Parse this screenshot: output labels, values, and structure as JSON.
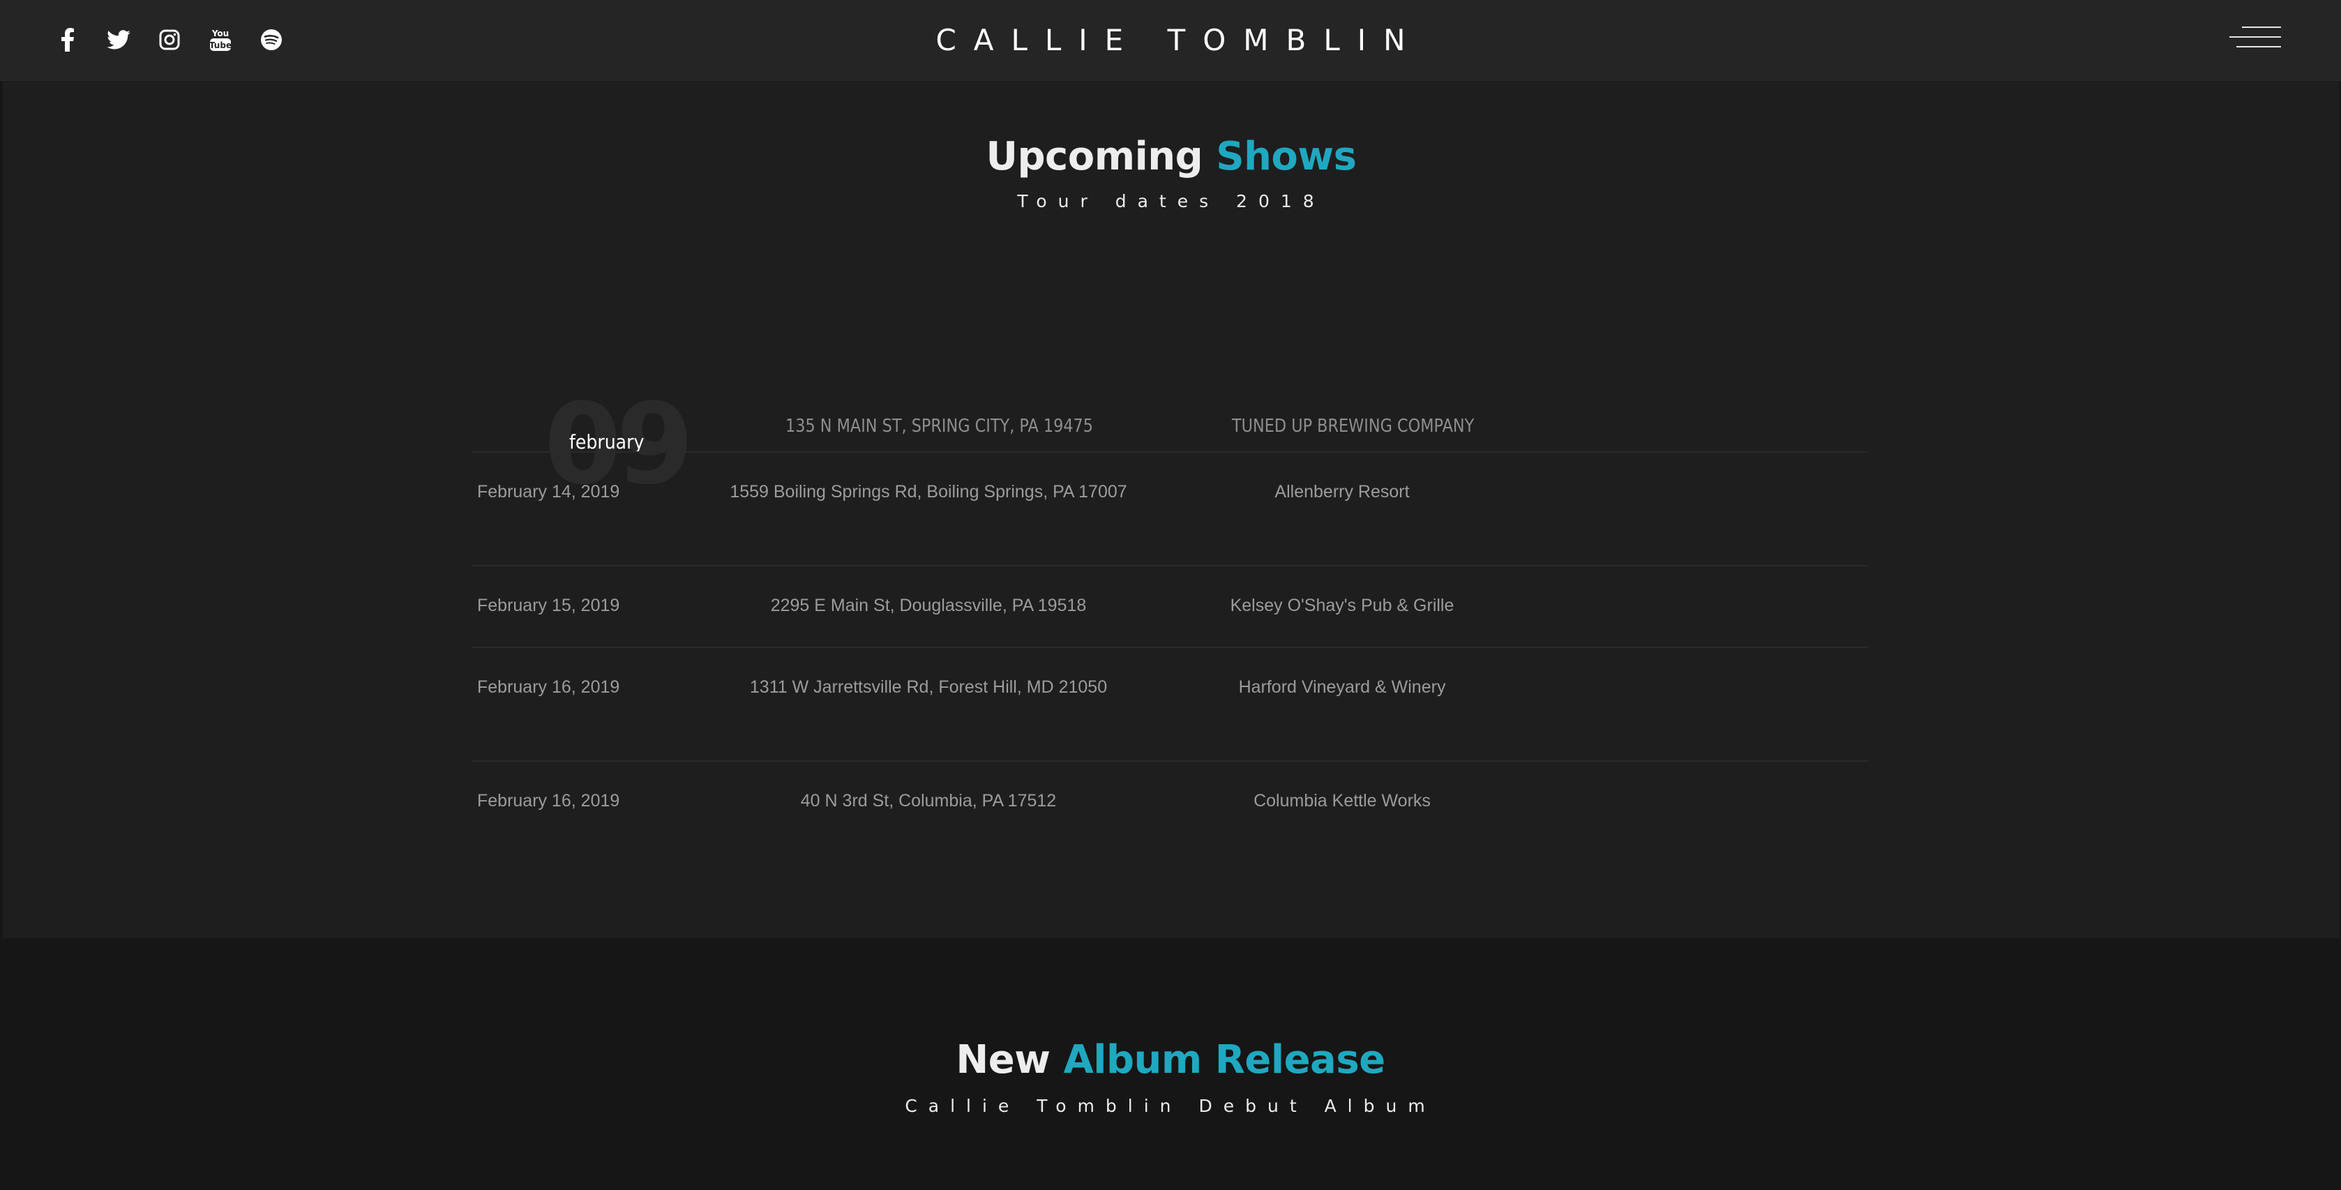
{
  "header": {
    "brand": "CALLIE TOMBLIN",
    "social": [
      "facebook-icon",
      "twitter-icon",
      "instagram-icon",
      "youtube-icon",
      "spotify-icon"
    ],
    "youtube_glyph": "You Tube"
  },
  "shows": {
    "title_main": "Upcoming",
    "title_accent": "Shows",
    "subtitle": "Tour dates 2018",
    "featured": {
      "day": "09",
      "month": "february",
      "address": "135 N MAIN ST, SPRING CITY, PA 19475",
      "venue": "TUNED UP BREWING COMPANY"
    },
    "rows": [
      {
        "date": "February 14, 2019",
        "address": "1559 Boiling Springs Rd, Boiling Springs, PA 17007",
        "venue": "Allenberry Resort"
      },
      {
        "date": "February 15, 2019",
        "address": "2295 E Main St, Douglassville, PA 19518",
        "venue": "Kelsey O'Shay's Pub & Grille"
      },
      {
        "date": "February 16, 2019",
        "address": "1311 W Jarrettsville Rd, Forest Hill, MD 21050",
        "venue": "Harford Vineyard & Winery"
      },
      {
        "date": "February 16, 2019",
        "address": "40 N 3rd St, Columbia, PA 17512",
        "venue": "Columbia Kettle Works"
      }
    ]
  },
  "album": {
    "title_main": "New",
    "title_accent": "Album Release",
    "subtitle": "Callie Tomblin Debut Album"
  },
  "colors": {
    "accent": "#1fa8c0",
    "header_bg": "#252525",
    "section_bg": "#1e1e1e",
    "page_bg": "#161616"
  }
}
